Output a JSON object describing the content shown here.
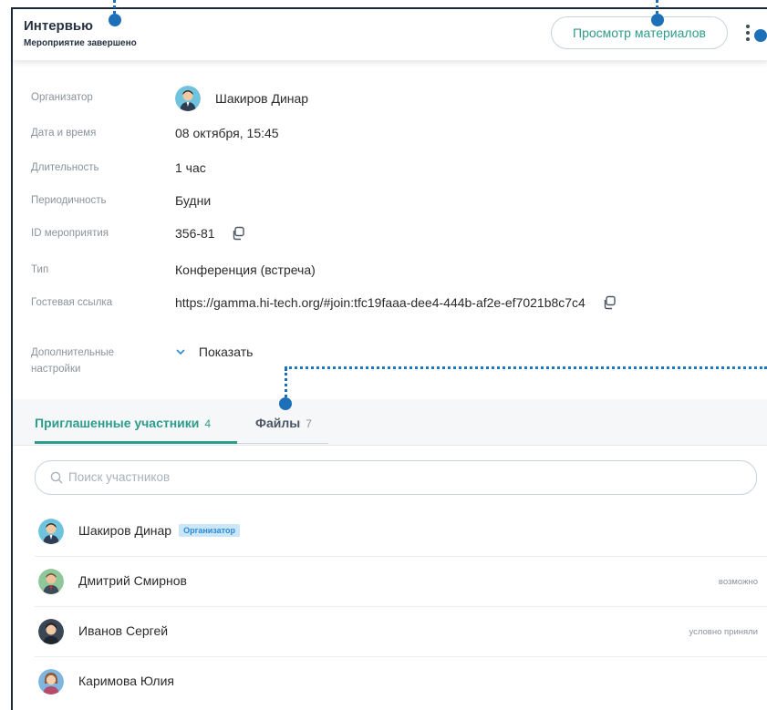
{
  "header": {
    "title": "Интервью",
    "subtitle": "Мероприятие завершено",
    "view_materials_label": "Просмотр материалов"
  },
  "details": {
    "organizer_label": "Организатор",
    "organizer_name": "Шакиров Динар",
    "datetime_label": "Дата и время",
    "datetime_value": "08 октября, 15:45",
    "duration_label": "Длительность",
    "duration_value": "1 час",
    "recurrence_label": "Периодичность",
    "recurrence_value": "Будни",
    "event_id_label": "ID мероприятия",
    "event_id_value": "356-81",
    "type_label": "Тип",
    "type_value": "Конференция (встреча)",
    "guest_link_label": "Гостевая ссылка",
    "guest_link_value": "https://gamma.hi-tech.org/#join:tfc19faaa-dee4-444b-af2e-ef7021b8c7c4",
    "extra_settings_label_1": "Дополнительные",
    "extra_settings_label_2": "настройки",
    "show_label": "Показать"
  },
  "tabs": [
    {
      "label": "Приглашенные участники",
      "count": "4"
    },
    {
      "label": "Файлы",
      "count": "7"
    }
  ],
  "search": {
    "placeholder": "Поиск участников"
  },
  "participants": [
    {
      "name": "Шакиров Динар",
      "badge": "Организатор",
      "status": ""
    },
    {
      "name": "Дмитрий Смирнов",
      "badge": "",
      "status": "возможно"
    },
    {
      "name": "Иванов Сергей",
      "badge": "",
      "status": "условно приняли"
    },
    {
      "name": "Каримова Юлия",
      "badge": "",
      "status": ""
    }
  ],
  "colors": {
    "accent": "#2e9c8a",
    "link": "#2a8bd6",
    "marker": "#1d6fb8"
  },
  "icons": [
    "more-vertical-icon",
    "copy-icon",
    "chevron-down-icon",
    "search-icon",
    "avatar"
  ]
}
